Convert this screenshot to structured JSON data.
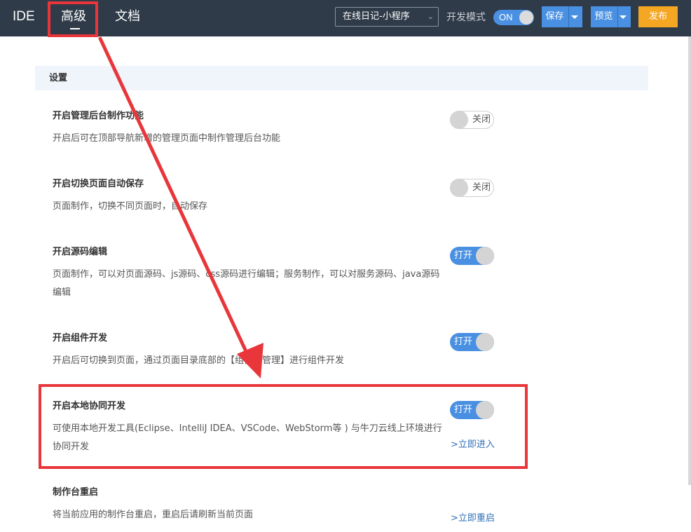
{
  "topbar": {
    "ide": "IDE",
    "advanced": "高级",
    "docs": "文档",
    "app_select": "在线日记-小程序",
    "dev_mode_label": "开发模式",
    "dev_mode_state": "ON",
    "save_label": "保存",
    "preview_label": "预览",
    "publish_label": "发布"
  },
  "settings": {
    "header": "设置",
    "items": [
      {
        "title": "开启管理后台制作功能",
        "desc": "开启后可在顶部导航新增的管理页面中制作管理后台功能",
        "state": "关闭"
      },
      {
        "title": "开启切换页面自动保存",
        "desc": "页面制作，切换不同页面时，自动保存",
        "state": "关闭"
      },
      {
        "title": "开启源码编辑",
        "desc": "页面制作，可以对页面源码、js源码、css源码进行编辑；服务制作，可以对服务源码、java源码编辑",
        "state": "打开"
      },
      {
        "title": "开启组件开发",
        "desc": "开启后可切换到页面，通过页面目录底部的【组件包管理】进行组件开发",
        "state": "打开"
      },
      {
        "title": "开启本地协同开发",
        "desc": "可使用本地开发工具(Eclipse、IntelliJ IDEA、VSCode、WebStorm等 ) 与牛刀云线上环境进行协同开发",
        "state": "打开",
        "link": ">立即进入"
      },
      {
        "title": "制作台重启",
        "desc": "将当前应用的制作台重启，重启后请刷新当前页面",
        "link": ">立即重启"
      }
    ]
  },
  "colors": {
    "topbar_bg": "#2f3b49",
    "accent": "#4a90e2",
    "publish": "#f5a623",
    "annotation": "#e8363b"
  }
}
